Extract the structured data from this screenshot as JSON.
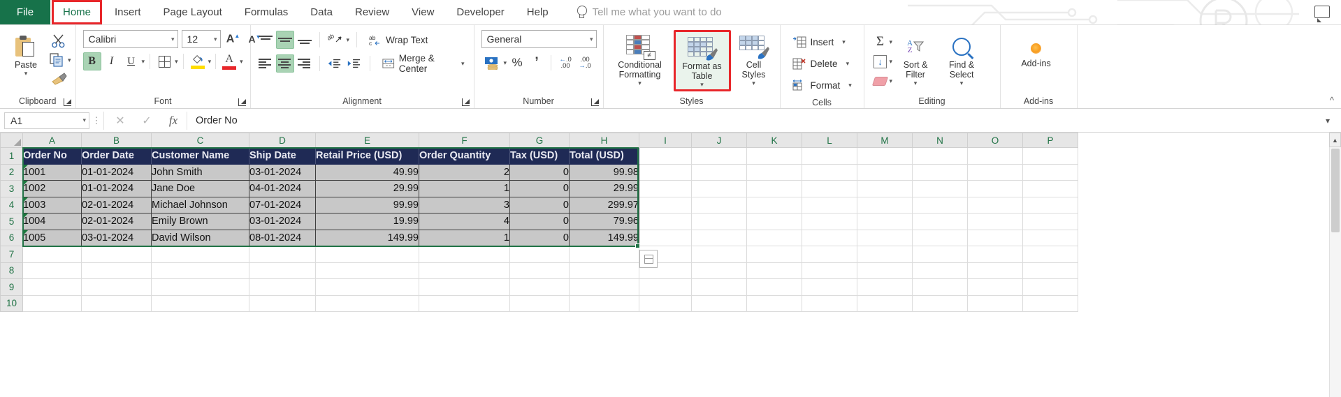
{
  "tabs": [
    {
      "label": "File",
      "active": false,
      "file": true
    },
    {
      "label": "Home",
      "active": true
    },
    {
      "label": "Insert",
      "active": false
    },
    {
      "label": "Page Layout",
      "active": false
    },
    {
      "label": "Formulas",
      "active": false
    },
    {
      "label": "Data",
      "active": false
    },
    {
      "label": "Review",
      "active": false
    },
    {
      "label": "View",
      "active": false
    },
    {
      "label": "Developer",
      "active": false
    },
    {
      "label": "Help",
      "active": false
    }
  ],
  "tellme": {
    "placeholder": "Tell me what you want to do",
    "icon": "lightbulb-icon"
  },
  "ribbon": {
    "clipboard": {
      "label": "Clipboard",
      "paste": "Paste",
      "cut": "cut-icon",
      "copy": "copy-icon",
      "format_painter": "format-painter-icon"
    },
    "font": {
      "label": "Font",
      "font_name": "Calibri",
      "font_size": "12",
      "grow": "A",
      "shrink": "A",
      "bold": "B",
      "italic": "I",
      "underline": "U",
      "borders": "borders-icon",
      "fill_color": "fill-color-icon",
      "font_color": "font-color-icon"
    },
    "alignment": {
      "label": "Alignment",
      "wrap_text": "Wrap Text",
      "merge_center": "Merge & Center",
      "orientation": "orientation-icon"
    },
    "number": {
      "label": "Number",
      "format": "General",
      "accounting": "accounting-format-icon",
      "percent": "%",
      "comma": "comma-style-icon",
      "increase_decimal": "increase-decimal-icon",
      "decrease_decimal": "decrease-decimal-icon"
    },
    "styles": {
      "label": "Styles",
      "conditional_formatting": "Conditional Formatting",
      "format_as_table_line1": "Format as",
      "format_as_table_line2": "Table",
      "cell_styles_line1": "Cell",
      "cell_styles_line2": "Styles",
      "highlight_color": "#e8262a"
    },
    "cells": {
      "label": "Cells",
      "insert": "Insert",
      "delete": "Delete",
      "format": "Format"
    },
    "editing": {
      "label": "Editing",
      "autosum": "autosum-icon",
      "fill": "fill-icon",
      "clear": "clear-icon",
      "sort_filter_line1": "Sort &",
      "sort_filter_line2": "Filter",
      "find_select_line1": "Find &",
      "find_select_line2": "Select"
    },
    "addins": {
      "label": "Add-ins",
      "button": "Add-ins"
    }
  },
  "formula_bar": {
    "name_box": "A1",
    "cancel": "✕",
    "enter": "✓",
    "fx": "fx",
    "value": "Order No"
  },
  "grid": {
    "columns": [
      "A",
      "B",
      "C",
      "D",
      "E",
      "F",
      "G",
      "H",
      "I",
      "J",
      "K",
      "L",
      "M",
      "N",
      "O",
      "P"
    ],
    "rows": [
      "1",
      "2",
      "3",
      "4",
      "5",
      "6",
      "7",
      "8",
      "9",
      "10"
    ],
    "headers": [
      "Order No",
      "Order Date",
      "Customer Name",
      "Ship Date",
      "Retail Price (USD)",
      "Order Quantity",
      "Tax (USD)",
      "Total (USD)"
    ],
    "data": [
      {
        "order_no": "1001",
        "order_date": "01-01-2024",
        "customer": "John Smith",
        "ship_date": "03-01-2024",
        "price": "49.99",
        "qty": "2",
        "tax": "0",
        "total": "99.98"
      },
      {
        "order_no": "1002",
        "order_date": "01-01-2024",
        "customer": "Jane Doe",
        "ship_date": "04-01-2024",
        "price": "29.99",
        "qty": "1",
        "tax": "0",
        "total": "29.99"
      },
      {
        "order_no": "1003",
        "order_date": "02-01-2024",
        "customer": "Michael Johnson",
        "ship_date": "07-01-2024",
        "price": "99.99",
        "qty": "3",
        "tax": "0",
        "total": "299.97"
      },
      {
        "order_no": "1004",
        "order_date": "02-01-2024",
        "customer": "Emily Brown",
        "ship_date": "03-01-2024",
        "price": "19.99",
        "qty": "4",
        "tax": "0",
        "total": "79.96"
      },
      {
        "order_no": "1005",
        "order_date": "03-01-2024",
        "customer": "David Wilson",
        "ship_date": "08-01-2024",
        "price": "149.99",
        "qty": "1",
        "tax": "0",
        "total": "149.99"
      }
    ]
  }
}
